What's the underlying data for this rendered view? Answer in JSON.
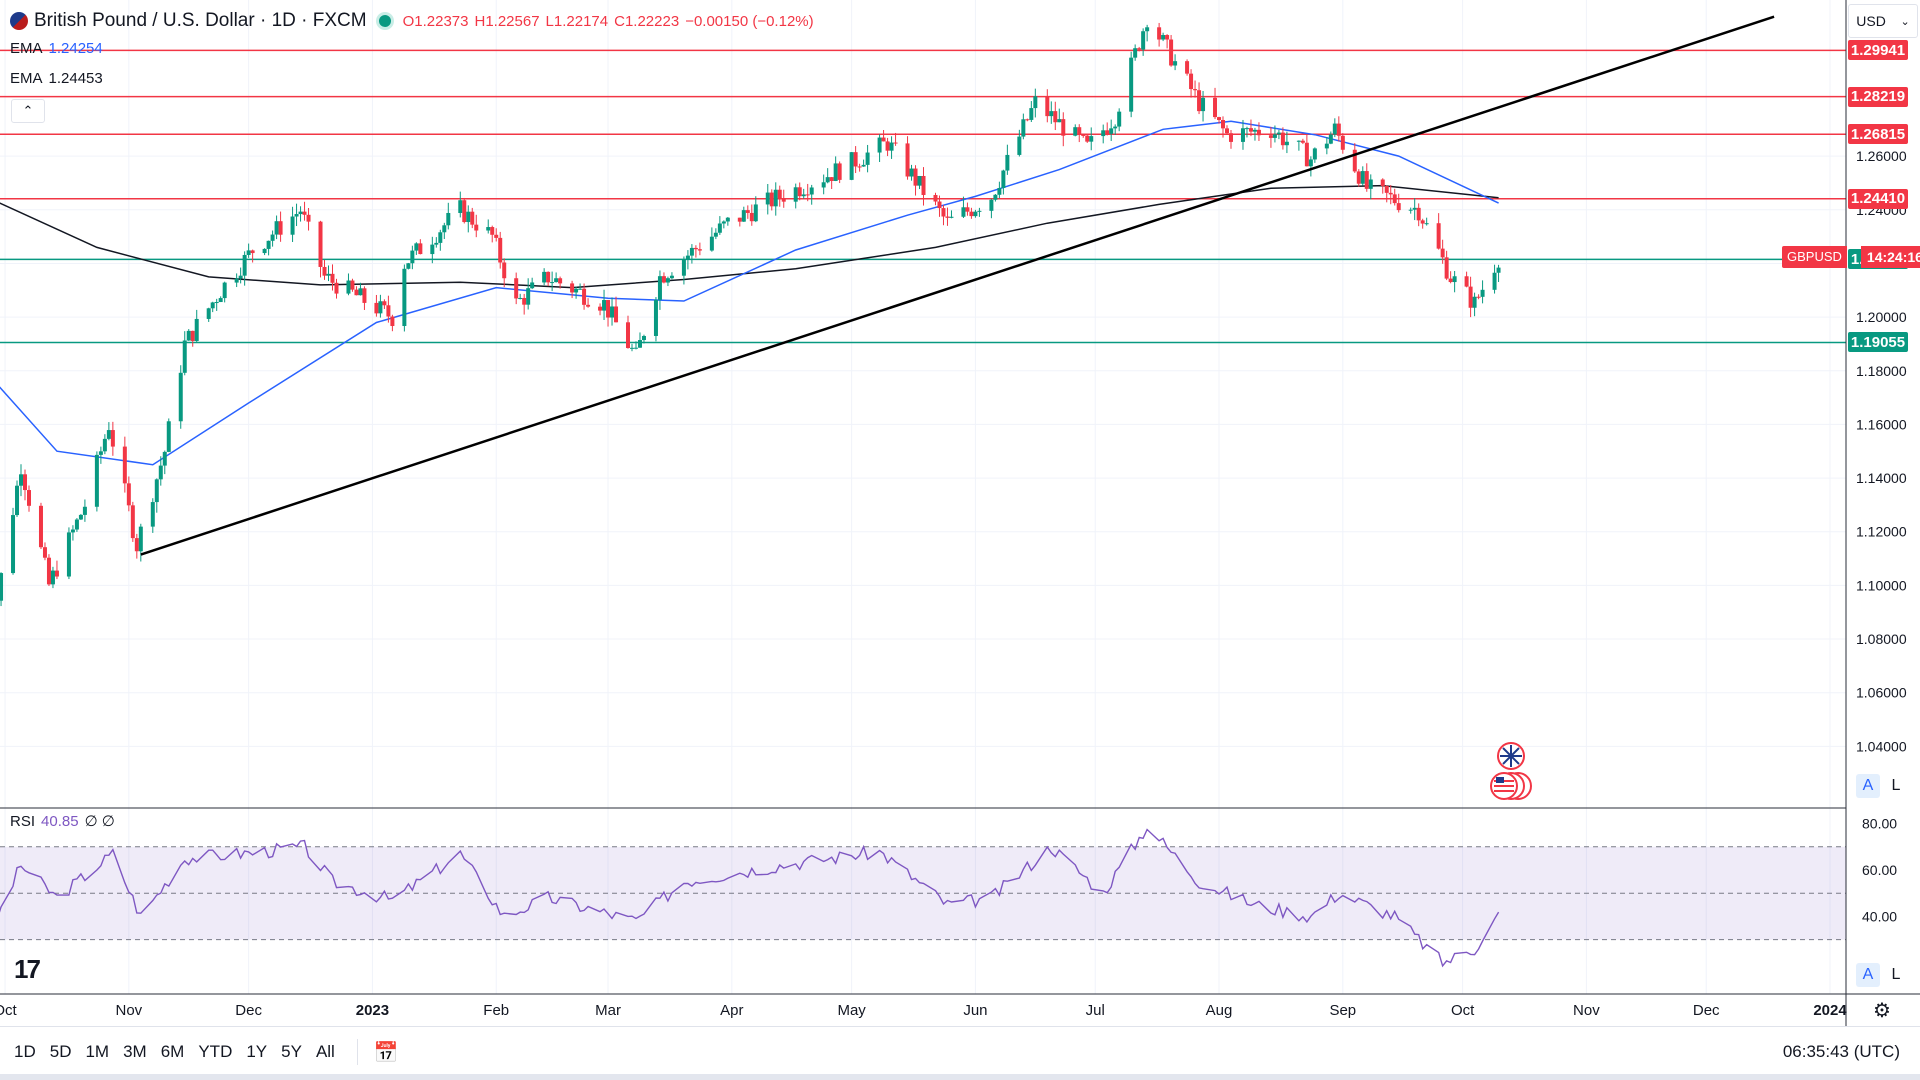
{
  "header": {
    "symbol_title": "British Pound / U.S. Dollar · 1D · FXCM",
    "open": "O1.22373",
    "high": "H1.22567",
    "low": "L1.22174",
    "close": "C1.22223",
    "change": "−0.00150 (−0.12%)",
    "currency": "USD"
  },
  "indicators": {
    "ema1_label": "EMA",
    "ema1_value": "1.24254",
    "ema2_label": "EMA",
    "ema2_value": "1.24453",
    "collapse_icon": "chevron-up-icon"
  },
  "rsi": {
    "label": "RSI",
    "value": "40.85",
    "extra": "∅ ∅"
  },
  "price_tags": [
    {
      "text": "1.29941",
      "color": "#f23645",
      "value": 1.29941
    },
    {
      "text": "1.28219",
      "color": "#f23645",
      "value": 1.28219
    },
    {
      "text": "1.26815",
      "color": "#f23645",
      "value": 1.26815
    },
    {
      "text": "1.24410",
      "color": "#f23645",
      "value": 1.2441
    },
    {
      "text": "1.22150",
      "color": "#089981",
      "value": 1.2215
    },
    {
      "text": "1.19055",
      "color": "#089981",
      "value": 1.19055
    }
  ],
  "ticker_label": {
    "name": "GBPUSD",
    "time": "14:24:16",
    "value": 1.2223
  },
  "scale_buttons": {
    "auto": "A",
    "log": "L"
  },
  "bottom": {
    "ranges": [
      "1D",
      "5D",
      "1M",
      "3M",
      "6M",
      "YTD",
      "1Y",
      "5Y",
      "All"
    ],
    "clock": "06:35:43 (UTC)"
  },
  "colors": {
    "up": "#089981",
    "down": "#f23645",
    "ema50": "#2962ff",
    "ema200": "#131722",
    "rsi": "#7e57c2"
  },
  "chart_data": {
    "type": "candlestick",
    "y_axis_ticks": [
      "1.04000",
      "1.06000",
      "1.08000",
      "1.10000",
      "1.12000",
      "1.14000",
      "1.16000",
      "1.18000",
      "1.20000",
      "1.22000",
      "1.24000",
      "1.26000"
    ],
    "ylim": [
      1.02,
      1.31
    ],
    "x_axis_ticks": [
      "Oct",
      "Nov",
      "Dec",
      "2023",
      "Feb",
      "Mar",
      "Apr",
      "May",
      "Jun",
      "Jul",
      "Aug",
      "Sep",
      "Oct",
      "Nov",
      "Dec",
      "2024"
    ],
    "rsi_ticks": [
      "40.00",
      "60.00",
      "80.00"
    ],
    "rsi_levels": [
      30,
      50,
      70
    ],
    "horizontal_levels": [
      1.29941,
      1.28219,
      1.26815,
      1.2441,
      1.2215,
      1.19055
    ],
    "trendline": {
      "from": [
        "2022-11-04",
        1.1115
      ],
      "to": [
        "2023-12-18",
        1.312
      ]
    },
    "price_path": [
      [
        "2022-09-26",
        1.07
      ],
      [
        "2022-10-05",
        1.145
      ],
      [
        "2022-10-12",
        1.1
      ],
      [
        "2022-10-21",
        1.13
      ],
      [
        "2022-10-27",
        1.16
      ],
      [
        "2022-11-03",
        1.115
      ],
      [
        "2022-11-10",
        1.15
      ],
      [
        "2022-11-15",
        1.19
      ],
      [
        "2022-11-24",
        1.21
      ],
      [
        "2022-12-02",
        1.225
      ],
      [
        "2022-12-14",
        1.24
      ],
      [
        "2022-12-20",
        1.215
      ],
      [
        "2023-01-06",
        1.2
      ],
      [
        "2023-01-09",
        1.22
      ],
      [
        "2023-01-23",
        1.24
      ],
      [
        "2023-01-31",
        1.23
      ],
      [
        "2023-02-06",
        1.205
      ],
      [
        "2023-02-14",
        1.215
      ],
      [
        "2023-02-28",
        1.205
      ],
      [
        "2023-03-08",
        1.185
      ],
      [
        "2023-03-14",
        1.215
      ],
      [
        "2023-03-31",
        1.235
      ],
      [
        "2023-04-13",
        1.245
      ],
      [
        "2023-04-28",
        1.255
      ],
      [
        "2023-05-10",
        1.265
      ],
      [
        "2023-05-25",
        1.235
      ],
      [
        "2023-06-05",
        1.245
      ],
      [
        "2023-06-16",
        1.28
      ],
      [
        "2023-06-29",
        1.263
      ],
      [
        "2023-07-06",
        1.275
      ],
      [
        "2023-07-14",
        1.312
      ],
      [
        "2023-07-27",
        1.28
      ],
      [
        "2023-08-03",
        1.268
      ],
      [
        "2023-08-14",
        1.27
      ],
      [
        "2023-08-24",
        1.259
      ],
      [
        "2023-08-30",
        1.27
      ],
      [
        "2023-09-07",
        1.248
      ],
      [
        "2023-09-20",
        1.24
      ],
      [
        "2023-09-28",
        1.215
      ],
      [
        "2023-10-04",
        1.205
      ],
      [
        "2023-10-10",
        1.2223
      ]
    ],
    "ema50_path": [
      [
        "2022-09-26",
        1.18
      ],
      [
        "2022-10-14",
        1.15
      ],
      [
        "2022-11-07",
        1.145
      ],
      [
        "2022-12-01",
        1.168
      ],
      [
        "2023-01-02",
        1.198
      ],
      [
        "2023-02-01",
        1.211
      ],
      [
        "2023-03-01",
        1.207
      ],
      [
        "2023-03-20",
        1.206
      ],
      [
        "2023-04-17",
        1.225
      ],
      [
        "2023-05-15",
        1.238
      ],
      [
        "2023-06-01",
        1.245
      ],
      [
        "2023-06-22",
        1.255
      ],
      [
        "2023-07-18",
        1.27
      ],
      [
        "2023-08-04",
        1.273
      ],
      [
        "2023-08-25",
        1.268
      ],
      [
        "2023-09-15",
        1.26
      ],
      [
        "2023-10-10",
        1.2425
      ]
    ],
    "ema200_path": [
      [
        "2022-09-26",
        1.245
      ],
      [
        "2022-10-24",
        1.226
      ],
      [
        "2022-11-21",
        1.215
      ],
      [
        "2022-12-19",
        1.212
      ],
      [
        "2023-01-23",
        1.213
      ],
      [
        "2023-02-20",
        1.211
      ],
      [
        "2023-03-20",
        1.214
      ],
      [
        "2023-04-17",
        1.218
      ],
      [
        "2023-05-22",
        1.226
      ],
      [
        "2023-06-19",
        1.235
      ],
      [
        "2023-07-17",
        1.242
      ],
      [
        "2023-08-14",
        1.248
      ],
      [
        "2023-09-11",
        1.249
      ],
      [
        "2023-10-10",
        1.2445
      ]
    ],
    "rsi_path": [
      [
        "2022-09-26",
        28
      ],
      [
        "2022-10-05",
        62
      ],
      [
        "2022-10-14",
        48
      ],
      [
        "2022-10-28",
        67
      ],
      [
        "2022-11-04",
        40
      ],
      [
        "2022-11-15",
        65
      ],
      [
        "2022-12-05",
        68
      ],
      [
        "2022-12-15",
        70
      ],
      [
        "2022-12-22",
        55
      ],
      [
        "2023-01-06",
        47
      ],
      [
        "2023-01-23",
        67
      ],
      [
        "2023-02-03",
        40
      ],
      [
        "2023-02-14",
        48
      ],
      [
        "2023-03-08",
        38
      ],
      [
        "2023-03-20",
        55
      ],
      [
        "2023-04-13",
        62
      ],
      [
        "2023-05-08",
        68
      ],
      [
        "2023-05-25",
        45
      ],
      [
        "2023-06-05",
        48
      ],
      [
        "2023-06-20",
        70
      ],
      [
        "2023-07-03",
        50
      ],
      [
        "2023-07-14",
        79
      ],
      [
        "2023-07-27",
        55
      ],
      [
        "2023-08-10",
        45
      ],
      [
        "2023-08-24",
        40
      ],
      [
        "2023-08-31",
        50
      ],
      [
        "2023-09-14",
        40
      ],
      [
        "2023-09-26",
        20
      ],
      [
        "2023-10-04",
        26
      ],
      [
        "2023-10-10",
        41
      ]
    ]
  }
}
